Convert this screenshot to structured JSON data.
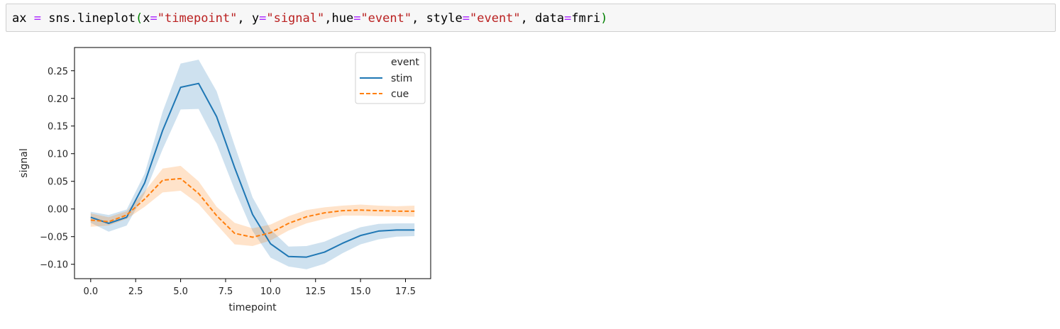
{
  "code_cell": {
    "tokens": [
      {
        "text": "ax ",
        "cls": ""
      },
      {
        "text": "=",
        "cls": "tok-op"
      },
      {
        "text": " sns.lineplot",
        "cls": ""
      },
      {
        "text": "(",
        "cls": "tok-paren"
      },
      {
        "text": "x",
        "cls": ""
      },
      {
        "text": "=",
        "cls": "tok-op"
      },
      {
        "text": "\"timepoint\"",
        "cls": "tok-str"
      },
      {
        "text": ", y",
        "cls": ""
      },
      {
        "text": "=",
        "cls": "tok-op"
      },
      {
        "text": "\"signal\"",
        "cls": "tok-str"
      },
      {
        "text": ",hue",
        "cls": ""
      },
      {
        "text": "=",
        "cls": "tok-op"
      },
      {
        "text": "\"event\"",
        "cls": "tok-str"
      },
      {
        "text": ", style",
        "cls": ""
      },
      {
        "text": "=",
        "cls": "tok-op"
      },
      {
        "text": "\"event\"",
        "cls": "tok-str"
      },
      {
        "text": ", data",
        "cls": ""
      },
      {
        "text": "=",
        "cls": "tok-op"
      },
      {
        "text": "fmri",
        "cls": ""
      },
      {
        "text": ")",
        "cls": "tok-paren"
      }
    ]
  },
  "chart_data": {
    "type": "line",
    "title": "",
    "xlabel": "timepoint",
    "ylabel": "signal",
    "xlim": [
      -0.9,
      18.9
    ],
    "ylim": [
      -0.126,
      0.292
    ],
    "xticks": [
      "0.0",
      "2.5",
      "5.0",
      "7.5",
      "10.0",
      "12.5",
      "15.0",
      "17.5"
    ],
    "yticks": [
      "−0.10",
      "−0.05",
      "0.00",
      "0.05",
      "0.10",
      "0.15",
      "0.20",
      "0.25"
    ],
    "legend": {
      "title": "event",
      "placement": "top-right"
    },
    "x": [
      0,
      1,
      2,
      3,
      4,
      5,
      6,
      7,
      8,
      9,
      10,
      11,
      12,
      13,
      14,
      15,
      16,
      17,
      18
    ],
    "series": [
      {
        "name": "stim",
        "color": "#1f77b4",
        "dash": "solid",
        "values": [
          -0.015,
          -0.026,
          -0.015,
          0.047,
          0.142,
          0.22,
          0.227,
          0.167,
          0.075,
          -0.01,
          -0.063,
          -0.086,
          -0.087,
          -0.078,
          -0.062,
          -0.048,
          -0.04,
          -0.038,
          -0.038
        ],
        "ci_low": [
          -0.025,
          -0.041,
          -0.03,
          0.028,
          0.108,
          0.18,
          0.181,
          0.118,
          0.035,
          -0.04,
          -0.088,
          -0.104,
          -0.109,
          -0.099,
          -0.08,
          -0.064,
          -0.055,
          -0.05,
          -0.049
        ],
        "ci_high": [
          -0.005,
          -0.011,
          -0.001,
          0.064,
          0.176,
          0.263,
          0.27,
          0.213,
          0.115,
          0.021,
          -0.037,
          -0.068,
          -0.067,
          -0.059,
          -0.045,
          -0.033,
          -0.027,
          -0.026,
          -0.026
        ]
      },
      {
        "name": "cue",
        "color": "#ff7f0e",
        "dash": "dashed",
        "values": [
          -0.02,
          -0.023,
          -0.011,
          0.018,
          0.052,
          0.055,
          0.028,
          -0.012,
          -0.044,
          -0.051,
          -0.043,
          -0.026,
          -0.014,
          -0.007,
          -0.003,
          -0.002,
          -0.003,
          -0.004,
          -0.004
        ],
        "ci_low": [
          -0.032,
          -0.03,
          -0.018,
          0.004,
          0.03,
          0.033,
          0.009,
          -0.028,
          -0.064,
          -0.067,
          -0.057,
          -0.039,
          -0.026,
          -0.018,
          -0.012,
          -0.012,
          -0.013,
          -0.013,
          -0.014
        ],
        "ci_high": [
          -0.008,
          -0.015,
          -0.004,
          0.032,
          0.073,
          0.078,
          0.05,
          0.004,
          -0.025,
          -0.035,
          -0.028,
          -0.013,
          -0.002,
          0.003,
          0.006,
          0.008,
          0.006,
          0.005,
          0.006
        ]
      }
    ]
  }
}
